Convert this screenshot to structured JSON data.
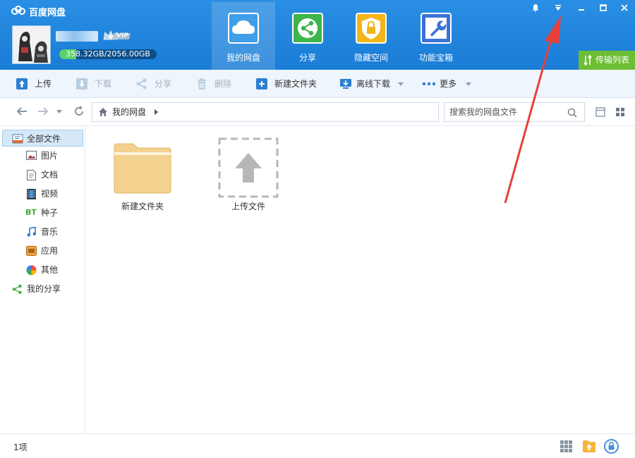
{
  "app": {
    "title": "百度网盘"
  },
  "user": {
    "vip_label": "VIP",
    "quota_text": "358.32GB/2056.00GB",
    "quota_used_fraction": 0.174
  },
  "nav": {
    "tabs": [
      {
        "label": "我的网盘",
        "icon": "cloud-icon",
        "active": true
      },
      {
        "label": "分享",
        "icon": "share-icon",
        "active": false
      },
      {
        "label": "隐藏空间",
        "icon": "lock-icon",
        "active": false
      },
      {
        "label": "功能宝箱",
        "icon": "wrench-icon",
        "active": false
      }
    ]
  },
  "window_controls": {
    "icons": [
      "bell-icon",
      "dropdown-menu-icon",
      "minimize-icon",
      "maximize-icon",
      "close-icon"
    ]
  },
  "transfer_list_label": "传输列表",
  "toolbar": {
    "upload": "上传",
    "download": "下载",
    "share": "分享",
    "delete": "删除",
    "new_folder": "新建文件夹",
    "offline_download": "离线下载",
    "more": "更多"
  },
  "address": {
    "path": "我的网盘",
    "search_placeholder": "搜索我的网盘文件"
  },
  "sidebar": {
    "items": [
      {
        "label": "全部文件",
        "icon": "all-files-icon",
        "active": true
      },
      {
        "label": "图片",
        "icon": "image-icon"
      },
      {
        "label": "文档",
        "icon": "document-icon"
      },
      {
        "label": "视频",
        "icon": "video-icon"
      },
      {
        "label": "种子",
        "icon": "bt-torrent-icon",
        "icon_text": "BT"
      },
      {
        "label": "音乐",
        "icon": "music-icon"
      },
      {
        "label": "应用",
        "icon": "app-icon"
      },
      {
        "label": "其他",
        "icon": "other-icon"
      },
      {
        "label": "我的分享",
        "icon": "my-share-icon"
      }
    ]
  },
  "files": [
    {
      "name": "新建文件夹",
      "type": "folder"
    },
    {
      "name": "上传文件",
      "type": "upload-placeholder"
    }
  ],
  "status": {
    "count_text": "1项"
  },
  "colors": {
    "header_blue": "#1f83dc",
    "accent_green": "#6cbe35",
    "annotation_red": "#e8403a"
  }
}
